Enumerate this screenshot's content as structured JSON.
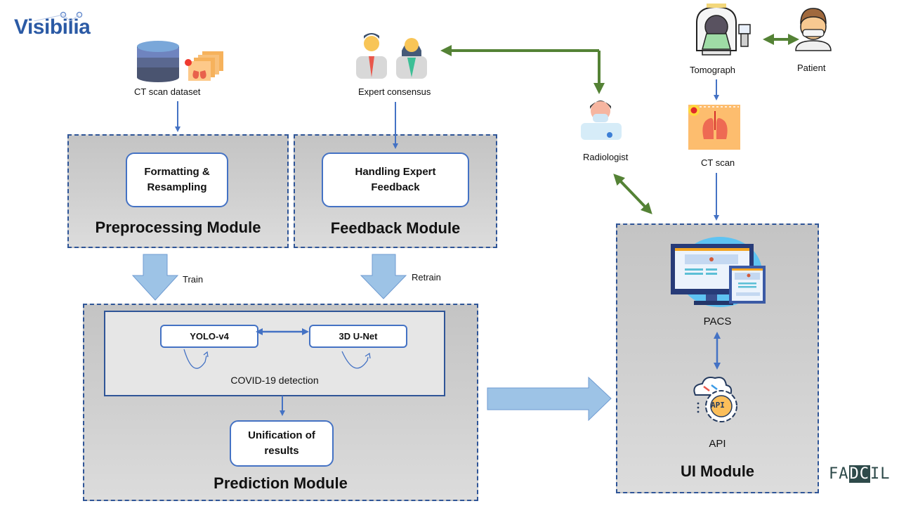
{
  "logos": {
    "visibilia": "Visibilia",
    "fadcil_prefix": "FA",
    "fadcil_highlight": "DC",
    "fadcil_suffix": "IL"
  },
  "sources": {
    "ct_dataset": {
      "label": "CT scan dataset",
      "icon": "database-icon"
    },
    "expert_consensus": {
      "label": "Expert consensus",
      "icon": "doctors-icon"
    },
    "radiologist": {
      "label": "Radiologist",
      "icon": "radiologist-icon"
    },
    "tomograph": {
      "label": "Tomograph",
      "icon": "ct-scanner-icon"
    },
    "patient": {
      "label": "Patient",
      "icon": "patient-icon"
    },
    "ct_scan": {
      "label": "CT scan",
      "icon": "lung-scan-icon"
    }
  },
  "modules": {
    "preprocessing": {
      "title": "Preprocessing Module",
      "step": "Formatting &\nResampling"
    },
    "feedback": {
      "title": "Feedback Module",
      "step": "Handling Expert\nFeedback"
    },
    "prediction": {
      "title": "Prediction Module",
      "models": [
        "YOLO-v4",
        "3D U-Net"
      ],
      "detection_label": "COVID-19 detection",
      "step": "Unification of\nresults"
    },
    "ui": {
      "title": "UI Module",
      "pacs_label": "PACS",
      "api_label": "API",
      "api_badge": "API"
    }
  },
  "arrows": {
    "train": "Train",
    "retrain": "Retrain"
  },
  "colors": {
    "blue_arrow": "#4472c4",
    "green_arrow": "#548235",
    "block_arrow": "#9dc3e6",
    "module_border": "#2f5597"
  }
}
